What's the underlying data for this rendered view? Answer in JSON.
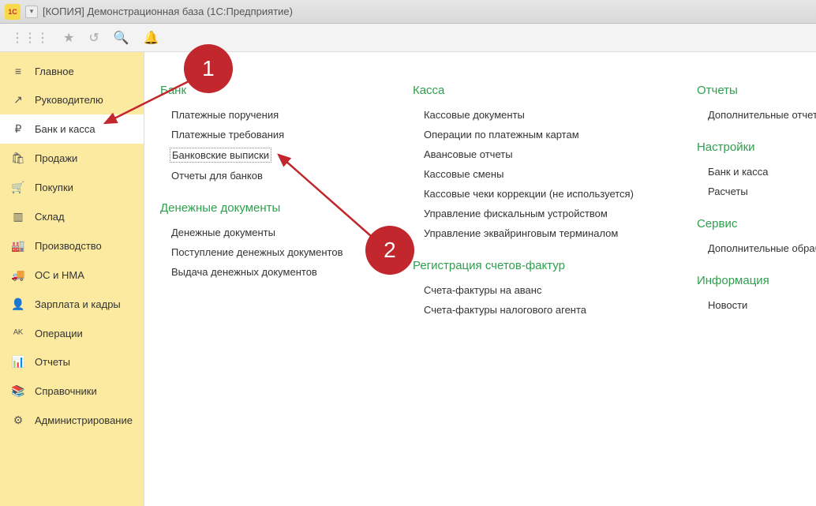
{
  "titlebar": {
    "logo_text": "1C",
    "title": "[КОПИЯ] Демонстрационная база  (1С:Предприятие)"
  },
  "sidebar": {
    "items": [
      {
        "icon": "≡",
        "label": "Главное"
      },
      {
        "icon": "↗",
        "label": "Руководителю"
      },
      {
        "icon": "₽",
        "label": "Банк и касса"
      },
      {
        "icon": "🛍",
        "label": "Продажи"
      },
      {
        "icon": "🛒",
        "label": "Покупки"
      },
      {
        "icon": "▥",
        "label": "Склад"
      },
      {
        "icon": "🏭",
        "label": "Производство"
      },
      {
        "icon": "🚚",
        "label": "ОС и НМА"
      },
      {
        "icon": "👤",
        "label": "Зарплата и кадры"
      },
      {
        "icon": "ᴬᴷ",
        "label": "Операции"
      },
      {
        "icon": "📊",
        "label": "Отчеты"
      },
      {
        "icon": "📚",
        "label": "Справочники"
      },
      {
        "icon": "⚙",
        "label": "Администрирование"
      }
    ],
    "active_index": 2
  },
  "content": {
    "col1": [
      {
        "title": "Банк",
        "items": [
          "Платежные поручения",
          "Платежные требования",
          "Банковские выписки",
          "Отчеты для банков"
        ],
        "highlight_index": 2
      },
      {
        "title": "Денежные документы",
        "items": [
          "Денежные документы",
          "Поступление денежных документов",
          "Выдача денежных документов"
        ]
      }
    ],
    "col2": [
      {
        "title": "Касса",
        "items": [
          "Кассовые документы",
          "Операции по платежным картам",
          "Авансовые отчеты",
          "Кассовые смены",
          "Кассовые чеки коррекции (не используется)",
          "Управление фискальным устройством",
          "Управление эквайринговым терминалом"
        ]
      },
      {
        "title": "Регистрация счетов-фактур",
        "items": [
          "Счета-фактуры на аванс",
          "Счета-фактуры налогового агента"
        ]
      }
    ],
    "col3": [
      {
        "title": "Отчеты",
        "items": [
          "Дополнительные отчеты"
        ]
      },
      {
        "title": "Настройки",
        "items": [
          "Банк и касса",
          "Расчеты"
        ]
      },
      {
        "title": "Сервис",
        "items": [
          "Дополнительные обработки"
        ]
      },
      {
        "title": "Информация",
        "items": [
          "Новости"
        ]
      }
    ]
  },
  "annotations": {
    "one": "1",
    "two": "2"
  }
}
